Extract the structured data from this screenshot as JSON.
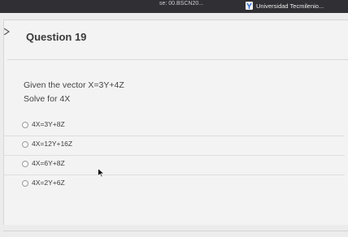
{
  "topbar": {
    "course_crumb": "se: 00.BSCN20...",
    "brand_name": "Universidad Tecmilenio..."
  },
  "question": {
    "title": "Question 19",
    "prompt_line1": "Given the vector X=3Y+4Z",
    "prompt_line2": "Solve for 4X"
  },
  "choices": [
    {
      "label": "4X=3Y+8Z"
    },
    {
      "label": "4X=12Y+16Z"
    },
    {
      "label": "4X=6Y+8Z"
    },
    {
      "label": "4X=2Y+6Z"
    }
  ]
}
